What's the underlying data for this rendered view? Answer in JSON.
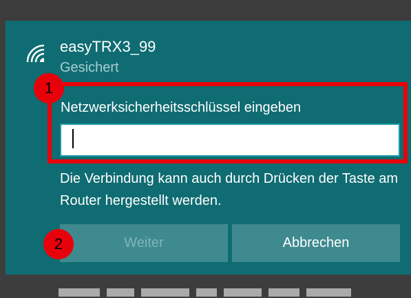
{
  "network": {
    "ssid": "easyTRX3_99",
    "status": "Gesichert",
    "icon": "wifi-icon"
  },
  "key_field": {
    "label": "Netzwerksicherheitsschlüssel eingeben",
    "value": ""
  },
  "hint": "Die Verbindung kann auch durch Drücken der Taste am Router hergestellt werden.",
  "buttons": {
    "next": "Weiter",
    "cancel": "Abbrechen"
  },
  "annotations": {
    "step1": "1",
    "step2": "2"
  },
  "colors": {
    "panel": "#0f6c72",
    "highlight": "#e8000b",
    "button": "#3e8a8f"
  }
}
